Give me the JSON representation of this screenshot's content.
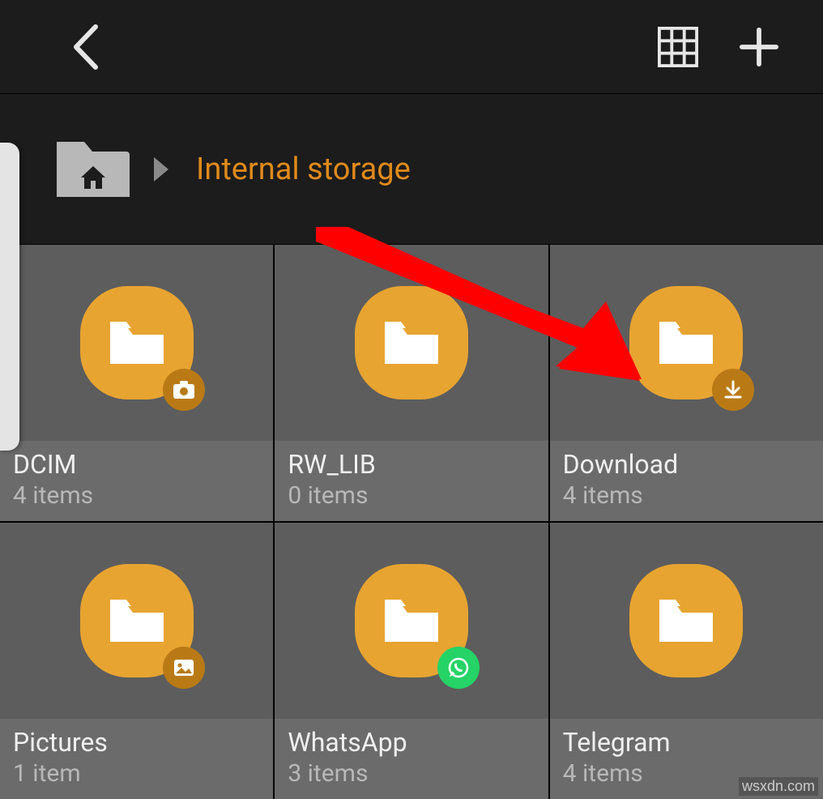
{
  "topbar": {
    "back_icon": "back-icon",
    "view_icon": "grid-view-icon",
    "add_icon": "plus-icon"
  },
  "breadcrumb": {
    "home_icon": "home-folder-icon",
    "arrow_icon": "chevron-right-icon",
    "title": "Internal storage"
  },
  "tiles": [
    {
      "name": "DCIM",
      "sub": "4 items",
      "badge": "camera-icon"
    },
    {
      "name": "RW_LIB",
      "sub": "0 items",
      "badge": null
    },
    {
      "name": "Download",
      "sub": "4 items",
      "badge": "download-icon"
    },
    {
      "name": "Pictures",
      "sub": "1 item",
      "badge": "picture-icon"
    },
    {
      "name": "WhatsApp",
      "sub": "3 items",
      "badge": "whatsapp-icon"
    },
    {
      "name": "Telegram",
      "sub": "4 items",
      "badge": null
    }
  ],
  "annotation": {
    "arrow": "red-arrow-annotation"
  },
  "watermark": "wsxdn.com",
  "colors": {
    "accent": "#e08a1a",
    "folder": "#e7a431",
    "badge_brown": "#b97a15",
    "badge_green": "#25d366",
    "arrow_red": "#ff0000"
  }
}
